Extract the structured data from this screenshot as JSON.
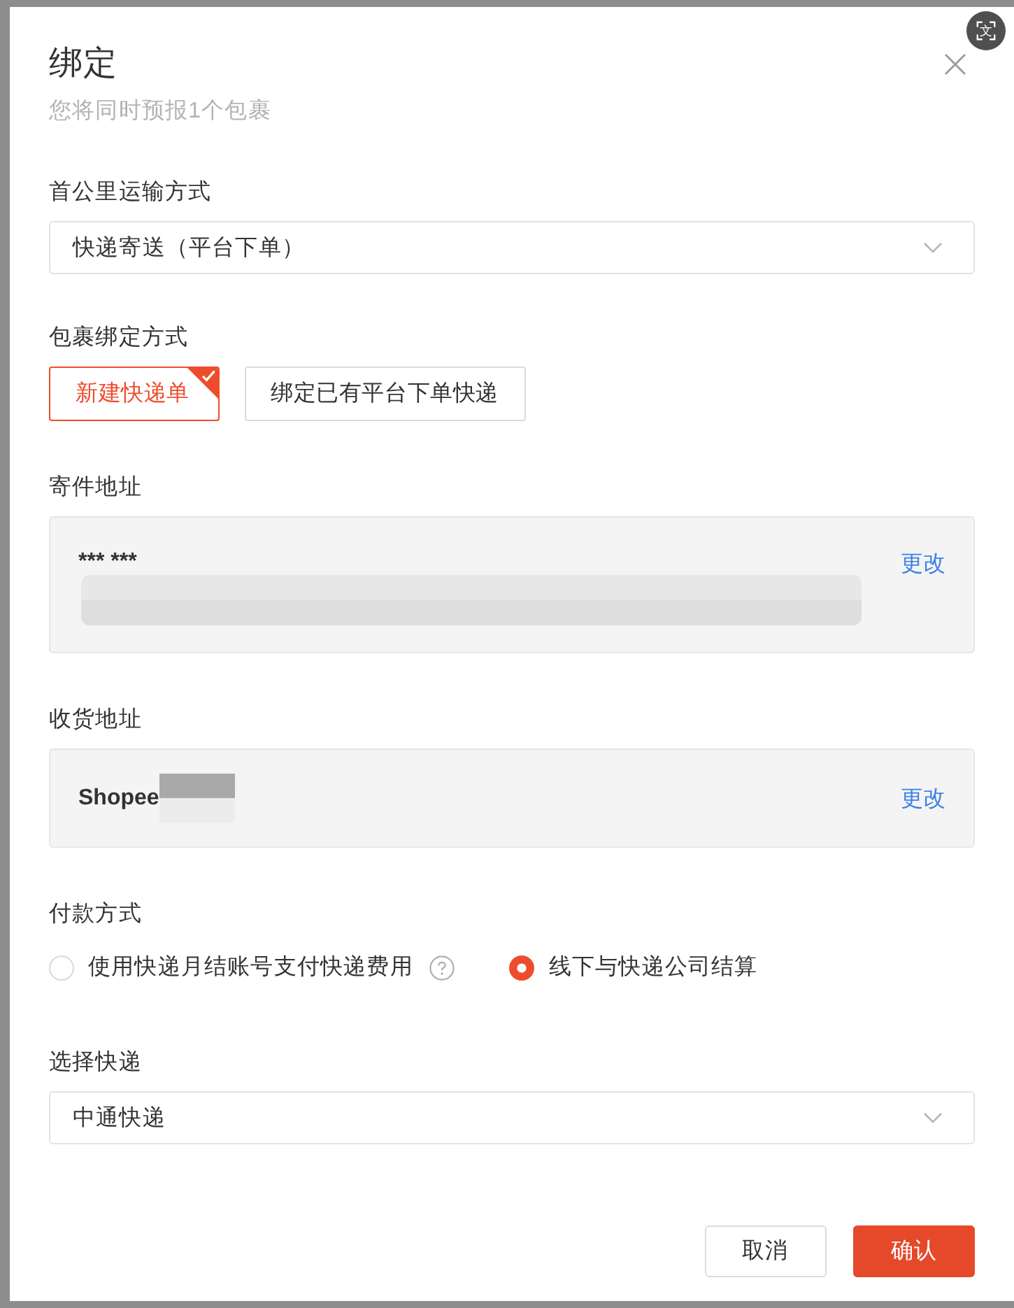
{
  "dialog": {
    "title": "绑定",
    "subtitle": "您将同时预报1个包裹"
  },
  "first_mile": {
    "label": "首公里运输方式",
    "value": "快递寄送（平台下单）"
  },
  "binding": {
    "label": "包裹绑定方式",
    "options": [
      {
        "label": "新建快递单",
        "selected": true
      },
      {
        "label": "绑定已有平台下单快递",
        "selected": false
      }
    ]
  },
  "sender": {
    "label": "寄件地址",
    "name": "*** ***",
    "redacted": true,
    "link": "更改"
  },
  "receiver": {
    "label": "收货地址",
    "name": "Shopee",
    "redacted": true,
    "link": "更改"
  },
  "payment": {
    "label": "付款方式",
    "options": [
      {
        "label": "使用快递月结账号支付快递费用",
        "selected": false,
        "help": true
      },
      {
        "label": "线下与快递公司结算",
        "selected": true,
        "help": false
      }
    ]
  },
  "courier": {
    "label": "选择快递",
    "value": "中通快递"
  },
  "buttons": [
    {
      "label": "取消",
      "kind": "secondary"
    },
    {
      "label": "确认",
      "kind": "primary"
    }
  ],
  "translate_badge": {
    "glyph": "文"
  }
}
